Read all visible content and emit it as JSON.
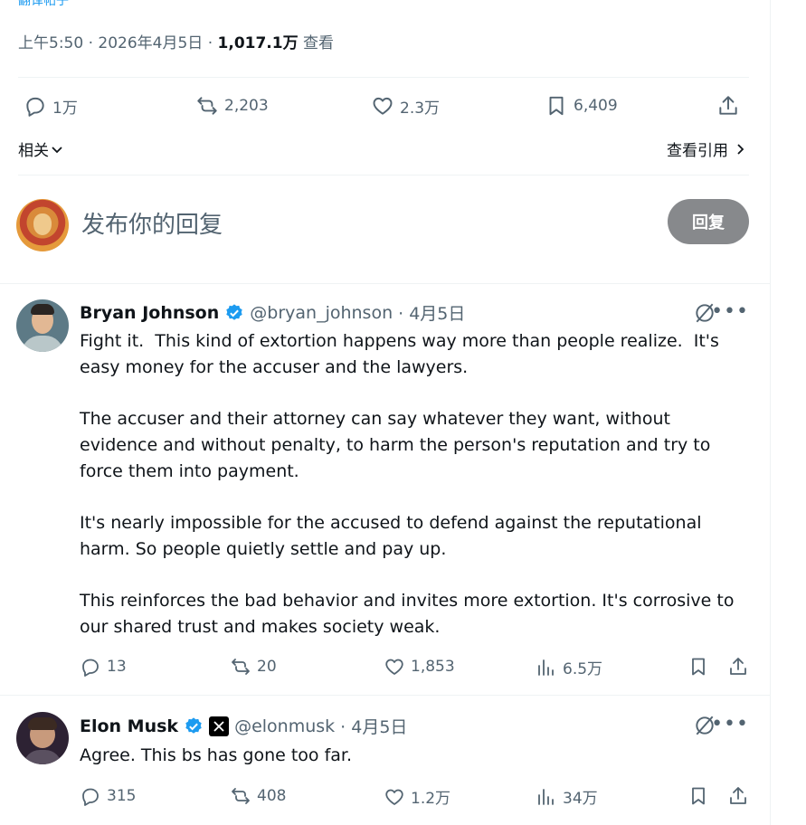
{
  "header_cut": "翻译帖子",
  "meta": {
    "time": "上午5:50",
    "date": "2026年4月5日",
    "views": "1,017.1万",
    "views_label": "查看"
  },
  "stats": {
    "replies": "1万",
    "reposts": "2,203",
    "likes": "2.3万",
    "bookmarks": "6,409"
  },
  "related_label": "相关",
  "quotes_label": "查看引用",
  "reply_box": {
    "placeholder": "发布你的回复",
    "button": "回复"
  },
  "tweets": [
    {
      "name": "Bryan Johnson",
      "handle": "@bryan_johnson",
      "date": "· 4月5日",
      "text": "Fight it.  This kind of extortion happens way more than people realize.  It's easy money for the accuser and the lawyers.\n\nThe accuser and their attorney can say whatever they want, without evidence and without penalty, to harm the person's reputation and try to force them into payment.\n\nIt's nearly impossible for the accused to defend against the reputational harm. So people quietly settle and pay up.\n\nThis reinforces the bad behavior and invites more extortion. It's corrosive to our shared trust and makes society weak.",
      "replies": "13",
      "reposts": "20",
      "likes": "1,853",
      "views": "6.5万"
    },
    {
      "name": "Elon Musk",
      "handle": "@elonmusk",
      "date": "· 4月5日",
      "text": "Agree. This bs has gone too far.",
      "replies": "315",
      "reposts": "408",
      "likes": "1.2万",
      "views": "34万"
    }
  ],
  "colors": {
    "text": "#0f1419",
    "muted": "#536471",
    "verified": "#1d9bf0",
    "divider": "#eff3f4",
    "reply_button": "#87898c"
  },
  "icons": [
    "reply-icon",
    "repost-icon",
    "like-icon",
    "bookmark-icon",
    "share-icon",
    "views-icon",
    "grok-icon",
    "more-icon",
    "verified-icon",
    "x-badge-icon",
    "chevron-down-icon",
    "chevron-right-icon"
  ]
}
